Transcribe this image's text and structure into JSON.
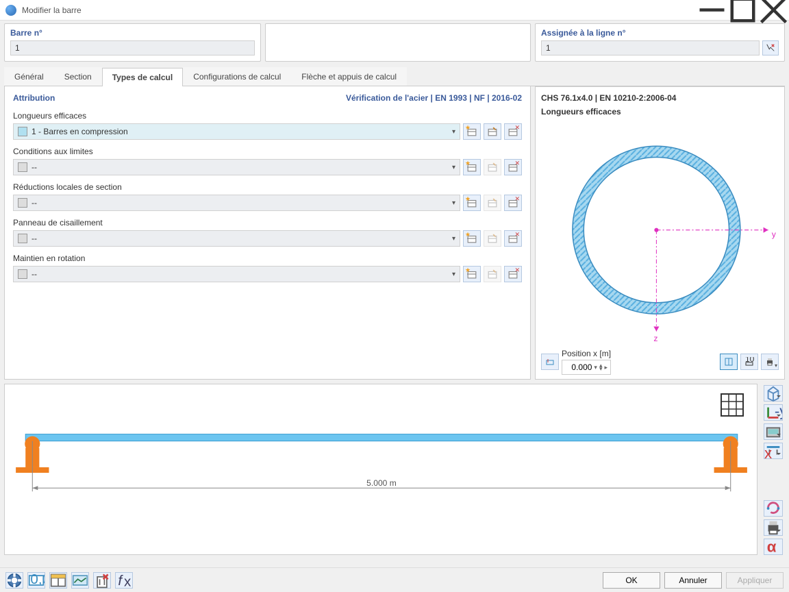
{
  "window": {
    "title": "Modifier la barre"
  },
  "header": {
    "barre_label": "Barre n°",
    "barre_value": "1",
    "assign_label": "Assignée à la ligne n°",
    "assign_value": "1"
  },
  "tabs": {
    "items": [
      {
        "label": "Général"
      },
      {
        "label": "Section"
      },
      {
        "label": "Types de calcul"
      },
      {
        "label": "Configurations de calcul"
      },
      {
        "label": "Flèche et appuis de calcul"
      }
    ]
  },
  "attribution": {
    "title": "Attribution",
    "norm": "Vérification de l'acier | EN 1993 | NF | 2016-02",
    "groups": [
      {
        "label": "Longueurs efficaces",
        "value": "1 - Barres en compression",
        "filled": true
      },
      {
        "label": "Conditions aux limites",
        "value": "--",
        "filled": false
      },
      {
        "label": "Réductions locales de section",
        "value": "--",
        "filled": false
      },
      {
        "label": "Panneau de cisaillement",
        "value": "--",
        "filled": false
      },
      {
        "label": "Maintien en rotation",
        "value": "--",
        "filled": false
      }
    ]
  },
  "section": {
    "profile": "CHS 76.1x4.0 | EN 10210-2:2006-04",
    "subtitle": "Longueurs efficaces",
    "axis_y": "y",
    "axis_z": "z",
    "position_label": "Position x [m]",
    "position_value": "0.000"
  },
  "beam": {
    "length": "5.000 m"
  },
  "buttons": {
    "ok": "OK",
    "cancel": "Annuler",
    "apply": "Appliquer"
  }
}
